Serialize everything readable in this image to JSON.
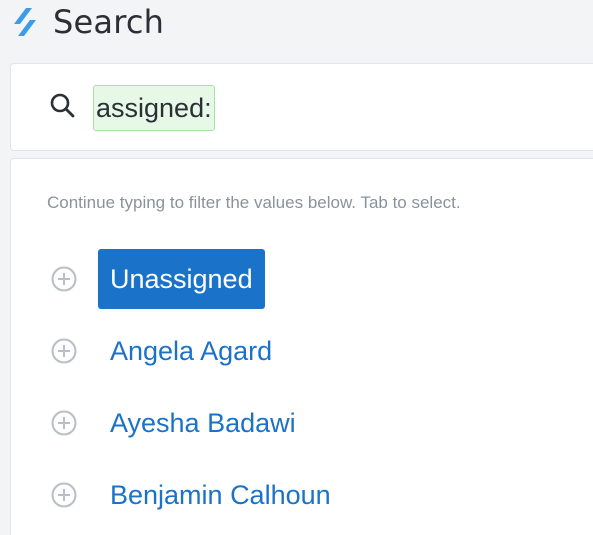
{
  "header": {
    "logo_icon": "brand-slash-logo",
    "title": "Search"
  },
  "search": {
    "icon": "search-icon",
    "token_text": "assigned:",
    "token_bg": "#e6f8e6",
    "token_border": "#a9e0a9"
  },
  "dropdown": {
    "hint": "Continue typing to filter the values below. Tab to select.",
    "options": [
      {
        "label": "Unassigned",
        "selected": true
      },
      {
        "label": "Angela Agard",
        "selected": false
      },
      {
        "label": "Ayesha Badawi",
        "selected": false
      },
      {
        "label": "Benjamin Calhoun",
        "selected": false
      }
    ]
  },
  "colors": {
    "accent": "#1b73c9",
    "brand": "#3d9be9",
    "hint_text": "#8a929c"
  }
}
